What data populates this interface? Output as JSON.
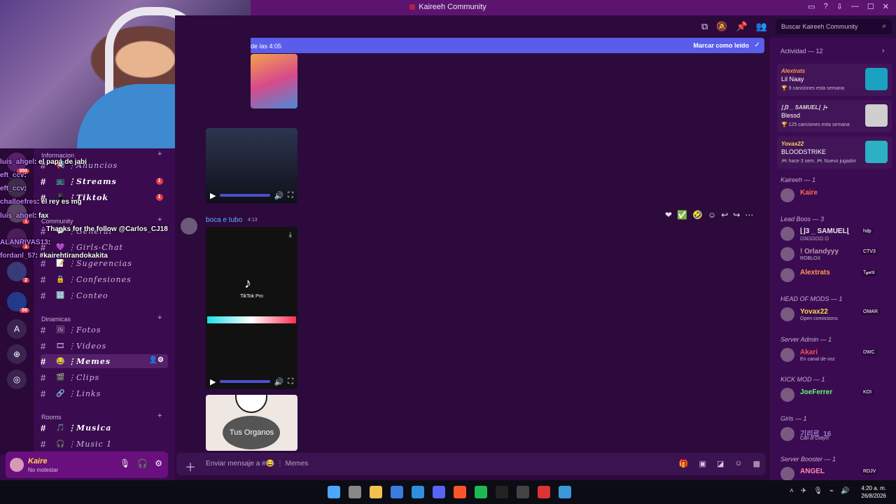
{
  "window": {
    "title": "Kaireeh Community",
    "controls": [
      "—",
      "☐",
      "✕"
    ]
  },
  "header": {
    "search_placeholder": "Buscar Kaireeh Community"
  },
  "new_messages_bar": {
    "text": "de las 4:05",
    "mark_read": "Marcar como leído"
  },
  "categories": [
    {
      "label": "Informacion",
      "channels": [
        {
          "name": "Anuncios",
          "icon": "📢",
          "unread": ""
        },
        {
          "name": "Streams",
          "icon": "📺",
          "unread": "1",
          "bold": true
        },
        {
          "name": "Tiktok",
          "icon": "📱",
          "unread": "1",
          "bold": true
        }
      ]
    },
    {
      "label": "Community",
      "channels": [
        {
          "name": "General",
          "icon": "💬",
          "unread": ""
        },
        {
          "name": "Girls-Chat",
          "icon": "💜",
          "unread": ""
        },
        {
          "name": "Sugerencias",
          "icon": "📝",
          "unread": ""
        },
        {
          "name": "Confesiones",
          "icon": "🔒",
          "unread": ""
        },
        {
          "name": "Conteo",
          "icon": "🔢",
          "unread": ""
        }
      ]
    },
    {
      "label": "Dinamicas",
      "channels": [
        {
          "name": "Fotos",
          "icon": "🖼",
          "unread": ""
        },
        {
          "name": "Videos",
          "icon": "🎞",
          "unread": ""
        },
        {
          "name": "Memes",
          "icon": "😂",
          "unread": "",
          "selected": true
        },
        {
          "name": "Clips",
          "icon": "🎬",
          "unread": ""
        },
        {
          "name": "Links",
          "icon": "🔗",
          "unread": ""
        }
      ]
    },
    {
      "label": "Rooms",
      "channels": [
        {
          "name": "Musica",
          "icon": "🎵",
          "unread": "",
          "bold": true
        },
        {
          "name": "Music 1",
          "icon": "🎧",
          "unread": ""
        }
      ]
    }
  ],
  "stream_chat": [
    {
      "user": "luis_ahgel",
      "text": ": el papá de jabi"
    },
    {
      "user": "eft_ccv",
      "text": ":"
    },
    {
      "user": "eft_ccv",
      "text": ":"
    },
    {
      "user": "challoefres",
      "text": ": el rey es mg"
    },
    {
      "user": "luis_ahgel",
      "text": ": fax"
    },
    {
      "user": "",
      "text": ": Thanks for the follow @Carlos_CJ18"
    },
    {
      "user": "ALANRIVAS13",
      "text": ":"
    },
    {
      "user": "fordanl_57",
      "text": ": #kairehtirandokakita"
    }
  ],
  "guild_badges": [
    "350",
    "1",
    "1",
    "2",
    "66"
  ],
  "user": {
    "name": "Kaire",
    "status": "No molestar"
  },
  "message": {
    "author": "boca e tubo",
    "time": "4:13",
    "video_label": "TikTok Pro",
    "meme_caption": "Tus Organos"
  },
  "composer": {
    "placeholder": "Enviar mensaje a #😂 ⋮ Memes"
  },
  "activity": {
    "label": "Actividad — 12",
    "cards": [
      {
        "name": "Alextrats",
        "game": "Lil Naay",
        "detail": "🏆 9 canciones esta semana",
        "color": "#ff9a4a",
        "thumb": "#1ba1c2"
      },
      {
        "name": "⌊⌋3 _ SAMUEL⌊ ⌋+",
        "game": "Blessd",
        "detail": "🏆 125 canciones esta semana",
        "color": "#d9d9d9",
        "thumb": "#cfcfcf"
      },
      {
        "name": "Yovax22",
        "game": "BLOODSTRIKE",
        "detail": "🎮 hace 3 sem. 🎮 Nuevo jugador",
        "color": "#ffd84b",
        "thumb": "#2bb0c4"
      }
    ]
  },
  "member_groups": [
    {
      "label": "Kaireeh — 1",
      "members": [
        {
          "name": "Kaire",
          "tag": "",
          "sub": "",
          "color": "#ff6a4b"
        }
      ]
    },
    {
      "label": "Lead Boos — 3",
      "members": [
        {
          "name": "⌊⌋3 _ SAMUEL⌊",
          "tag": "hdp",
          "sub": "⊡3⊡⊡⊡⊡ ⊡",
          "color": "#e8e8e8"
        },
        {
          "name": "! Orlandyyy",
          "tag": "CTV3",
          "sub": "ROBLOX",
          "color": "#b99ab0"
        },
        {
          "name": "Alextrats",
          "tag": "T𝓰𝓮si",
          "sub": "",
          "color": "#ff9a4a"
        }
      ]
    },
    {
      "label": "HEAD OF MODS — 1",
      "members": [
        {
          "name": "Yovax22",
          "tag": "OMAR",
          "sub": "Open comissions",
          "color": "#ffd84b"
        }
      ]
    },
    {
      "label": "Server Admin — 1",
      "members": [
        {
          "name": "Akari",
          "tag": "DWC",
          "sub": "En canal de voz",
          "color": "#ff4d4d"
        }
      ]
    },
    {
      "label": "KICK MOD — 1",
      "members": [
        {
          "name": "JoeFerrer",
          "tag": "KOI",
          "sub": "",
          "color": "#5cff6b"
        }
      ]
    },
    {
      "label": "Girls — 1",
      "members": [
        {
          "name": "기리르_16",
          "tag": "",
          "sub": "Call of Duty®",
          "color": "#a37ad0"
        }
      ]
    },
    {
      "label": "Server Booster — 1",
      "members": [
        {
          "name": "ANGEL",
          "tag": "RDJV",
          "sub": "",
          "color": "#ff8ab0"
        }
      ]
    }
  ],
  "clock": {
    "time": "4:20 a. m.",
    "date": "26/8/2026"
  }
}
